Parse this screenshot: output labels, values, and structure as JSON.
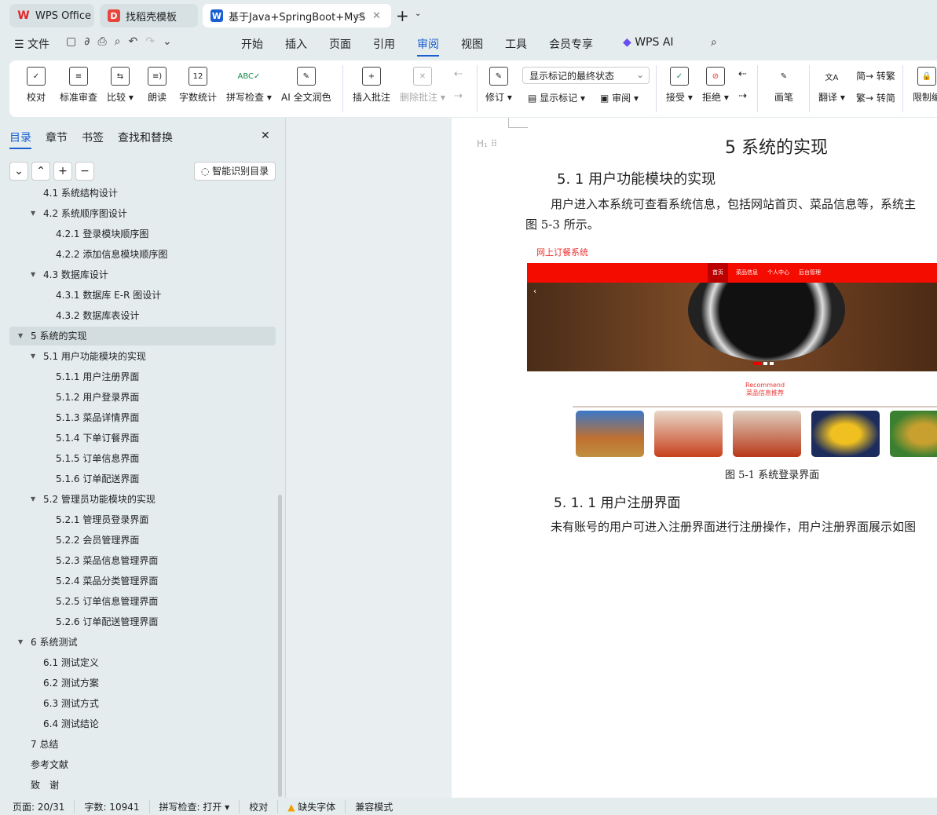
{
  "tabs": [
    {
      "label": "WPS Office",
      "icon": "wps-logo-icon"
    },
    {
      "label": "找稻壳模板",
      "icon": "docer-icon"
    },
    {
      "label": "基于Java+SpringBoot+MyS",
      "icon": "word-doc-icon"
    }
  ],
  "menu": {
    "file": "文件",
    "items": [
      "开始",
      "插入",
      "页面",
      "引用",
      "审阅",
      "视图",
      "工具",
      "会员专享"
    ],
    "active": "审阅",
    "ai": "WPS AI"
  },
  "ribbon": {
    "proofread": "校对",
    "standard_review": "标准审查",
    "compare": "比较",
    "read_aloud": "朗读",
    "word_count": "字数统计",
    "spell_check": "拼写检查",
    "ai_polish": "AI 全文润色",
    "insert_comment": "插入批注",
    "delete_comment": "删除批注",
    "revise": "修订",
    "markup_state": "显示标记的最终状态",
    "show_markup": "显示标记",
    "review": "审阅",
    "accept": "接受",
    "reject": "拒绝",
    "pen": "画笔",
    "translate": "翻译",
    "to_traditional": "转繁",
    "to_simplified": "转简",
    "restrict": "限制编"
  },
  "sidebar": {
    "tabs": [
      "目录",
      "章节",
      "书签",
      "查找和替换"
    ],
    "smart_toc": "智能识别目录",
    "items": [
      {
        "label": "4.1 系统结构设计",
        "level": 2,
        "arrow": false
      },
      {
        "label": "4.2 系统顺序图设计",
        "level": 2,
        "arrow": true
      },
      {
        "label": "4.2.1 登录模块顺序图",
        "level": 3
      },
      {
        "label": "4.2.2 添加信息模块顺序图",
        "level": 3
      },
      {
        "label": "4.3  数据库设计",
        "level": 2,
        "arrow": true
      },
      {
        "label": "4.3.1  数据库 E-R 图设计",
        "level": 3
      },
      {
        "label": "4.3.2  数据库表设计",
        "level": 3
      },
      {
        "label": "5  系统的实现",
        "level": 1,
        "arrow": true,
        "selected": true
      },
      {
        "label": "5.1  用户功能模块的实现",
        "level": 2,
        "arrow": true
      },
      {
        "label": "5.1.1 用户注册界面",
        "level": 3
      },
      {
        "label": "5.1.2 用户登录界面",
        "level": 3
      },
      {
        "label": "5.1.3 菜品详情界面",
        "level": 3
      },
      {
        "label": "5.1.4 下单订餐界面",
        "level": 3
      },
      {
        "label": "5.1.5 订单信息界面",
        "level": 3
      },
      {
        "label": "5.1.6 订单配送界面",
        "level": 3
      },
      {
        "label": "5.2  管理员功能模块的实现",
        "level": 2,
        "arrow": true
      },
      {
        "label": "5.2.1 管理员登录界面",
        "level": 3
      },
      {
        "label": "5.2.2 会员管理界面",
        "level": 3
      },
      {
        "label": "5.2.3 菜品信息管理界面",
        "level": 3
      },
      {
        "label": "5.2.4 菜品分类管理界面",
        "level": 3
      },
      {
        "label": "5.2.5 订单信息管理界面",
        "level": 3
      },
      {
        "label": "5.2.6 订单配送管理界面",
        "level": 3
      },
      {
        "label": "6  系统测试",
        "level": 1,
        "arrow": true
      },
      {
        "label": "6.1 测试定义",
        "level": 2
      },
      {
        "label": "6.2 测试方案",
        "level": 2
      },
      {
        "label": "6.3 测试方式",
        "level": 2
      },
      {
        "label": "6.4 测试结论",
        "level": 2
      },
      {
        "label": "7 总结",
        "level": 1
      },
      {
        "label": "参考文献",
        "level": 1
      },
      {
        "label": "致　谢",
        "level": 1
      }
    ]
  },
  "doc": {
    "h1": "5  系统的实现",
    "h2": "5. 1  用户功能模块的实现",
    "p1": "用户进入本系统可查看系统信息，包括网站首页、菜品信息等，系统主",
    "p1b": "图 5-3 所示。",
    "figure": {
      "site_title": "网上订餐系统",
      "nav": [
        "首页",
        "菜品信息",
        "个人中心",
        "后台管理"
      ],
      "recommend": "Recommend",
      "recommend_cn": "菜品信息推荐"
    },
    "caption": "图 5-1 系统登录界面",
    "h3": "5. 1. 1 用户注册界面",
    "p2": "未有账号的用户可进入注册界面进行注册操作，用户注册界面展示如图"
  },
  "status": {
    "page": "页面: 20/31",
    "words": "字数: 10941",
    "spell": "拼写检查: 打开",
    "proof": "校对",
    "missing_font": "缺失字体",
    "compat": "兼容模式"
  }
}
